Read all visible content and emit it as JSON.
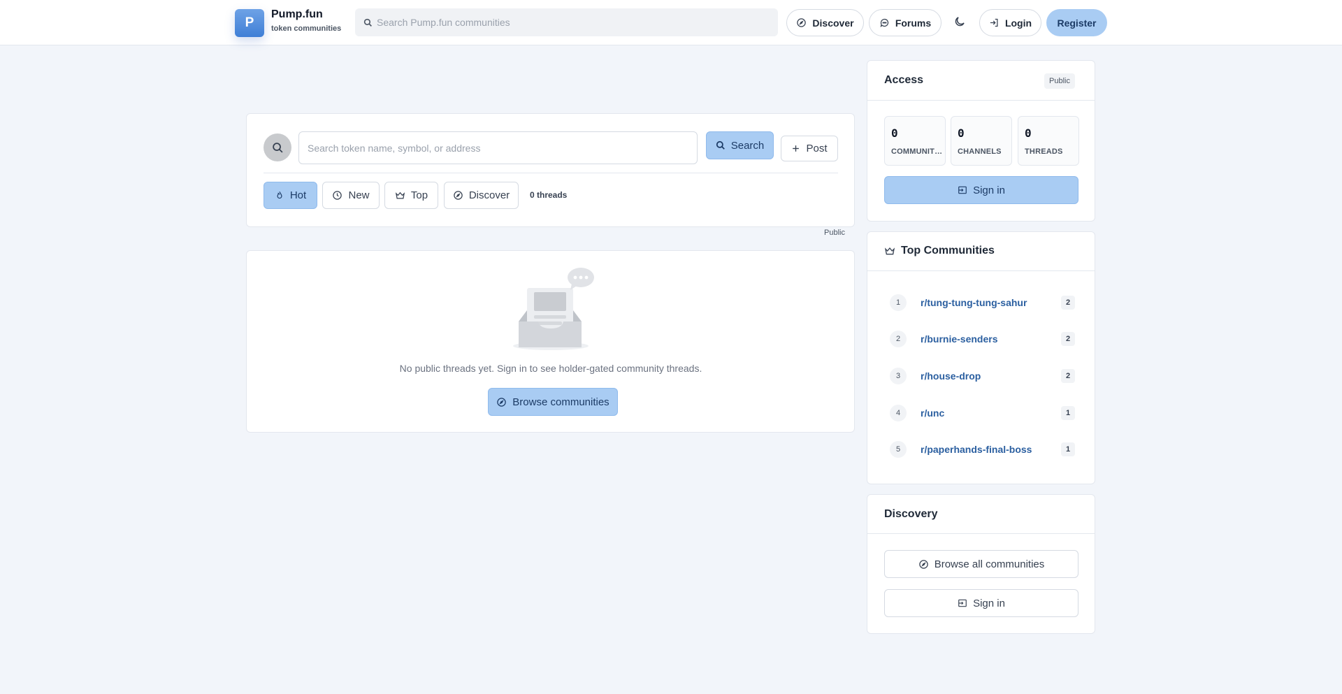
{
  "header": {
    "logo_letter": "P",
    "brand_name": "Pump.fun",
    "brand_subtitle": "token communities",
    "search_placeholder": "Search Pump.fun communities",
    "nav": {
      "discover": "Discover",
      "forums": "Forums",
      "login": "Login",
      "register": "Register"
    }
  },
  "feed": {
    "search_placeholder": "Search token name, symbol, or address",
    "search_button": "Search",
    "post_button": "Post",
    "tabs": {
      "hot": "Hot",
      "new": "New",
      "top": "Top",
      "discover": "Discover"
    },
    "active_tab": "Hot",
    "threads_count": "0 threads",
    "visibility_tag": "Public",
    "empty_message": "No public threads yet. Sign in to see holder-gated community threads.",
    "browse_button": "Browse communities"
  },
  "sidebar": {
    "access": {
      "title": "Access",
      "badge": "Public",
      "stats": [
        {
          "value": "0",
          "label": "COMMUNITIES"
        },
        {
          "value": "0",
          "label": "CHANNELS"
        },
        {
          "value": "0",
          "label": "THREADS"
        }
      ],
      "signin_button": "Sign in"
    },
    "top_communities": {
      "title": "Top Communities",
      "items": [
        {
          "rank": "1",
          "name": "r/tung-tung-tung-sahur",
          "count": "2"
        },
        {
          "rank": "2",
          "name": "r/burnie-senders",
          "count": "2"
        },
        {
          "rank": "3",
          "name": "r/house-drop",
          "count": "2"
        },
        {
          "rank": "4",
          "name": "r/unc",
          "count": "1"
        },
        {
          "rank": "5",
          "name": "r/paperhands-final-boss",
          "count": "1"
        }
      ]
    },
    "discovery": {
      "title": "Discovery",
      "browse_all": "Browse all communities",
      "signin": "Sign in"
    }
  },
  "colors": {
    "accent": "#a9ccf3",
    "accent_text": "#1c3b66",
    "link": "#2b5fa0",
    "background": "#f2f5fa"
  }
}
